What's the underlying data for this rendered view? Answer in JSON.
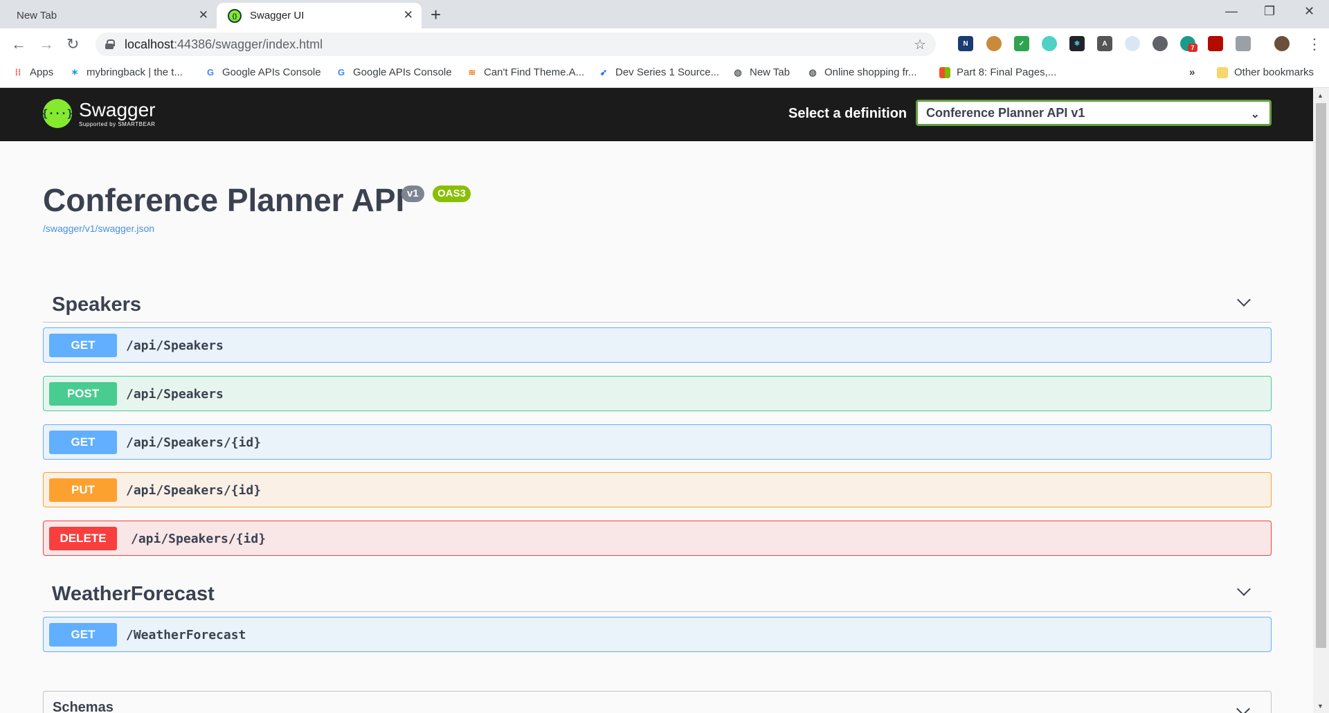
{
  "browser": {
    "tabs": [
      {
        "title": "New Tab"
      },
      {
        "title": "Swagger UI"
      }
    ],
    "url": {
      "host": "localhost",
      "rest": ":44386/swagger/index.html"
    },
    "bookmarks": [
      {
        "label": "Apps",
        "icon": "apps-grid-icon"
      },
      {
        "label": "mybringback | the t...",
        "icon": "bringback-icon"
      },
      {
        "label": "Google APIs Console",
        "icon": "google-icon"
      },
      {
        "label": "Google APIs Console",
        "icon": "google-icon"
      },
      {
        "label": "Can't Find Theme.A...",
        "icon": "stackoverflow-icon"
      },
      {
        "label": "Dev Series 1 Source...",
        "icon": "rocket-icon"
      },
      {
        "label": "New Tab",
        "icon": "globe-icon"
      },
      {
        "label": "Online shopping fr...",
        "icon": "globe-icon"
      },
      {
        "label": "Part 8: Final Pages,...",
        "icon": "microsoft-icon"
      }
    ],
    "bookmarks_more": "»",
    "other_bookmarks": "Other bookmarks",
    "extension_badge": "7"
  },
  "swagger": {
    "logo_name": "Swagger",
    "logo_sub": "Supported by SMARTBEAR",
    "definition_label": "Select a definition",
    "definition_value": "Conference Planner API v1",
    "title": "Conference Planner API",
    "version": "v1",
    "oas": "OAS3",
    "spec_link": "/swagger/v1/swagger.json",
    "tags": [
      {
        "name": "Speakers",
        "operations": [
          {
            "method": "GET",
            "path": "/api/Speakers"
          },
          {
            "method": "POST",
            "path": "/api/Speakers"
          },
          {
            "method": "GET",
            "path": "/api/Speakers/{id}"
          },
          {
            "method": "PUT",
            "path": "/api/Speakers/{id}"
          },
          {
            "method": "DELETE",
            "path": "/api/Speakers/{id}"
          }
        ]
      },
      {
        "name": "WeatherForecast",
        "operations": [
          {
            "method": "GET",
            "path": "/WeatherForecast"
          }
        ]
      }
    ],
    "schemas_label": "Schemas"
  },
  "colors": {
    "get": "#61affe",
    "post": "#49cc90",
    "put": "#fca130",
    "delete": "#f93e3e",
    "swagger_green": "#85ea2d",
    "topbar": "#1b1b1b"
  }
}
